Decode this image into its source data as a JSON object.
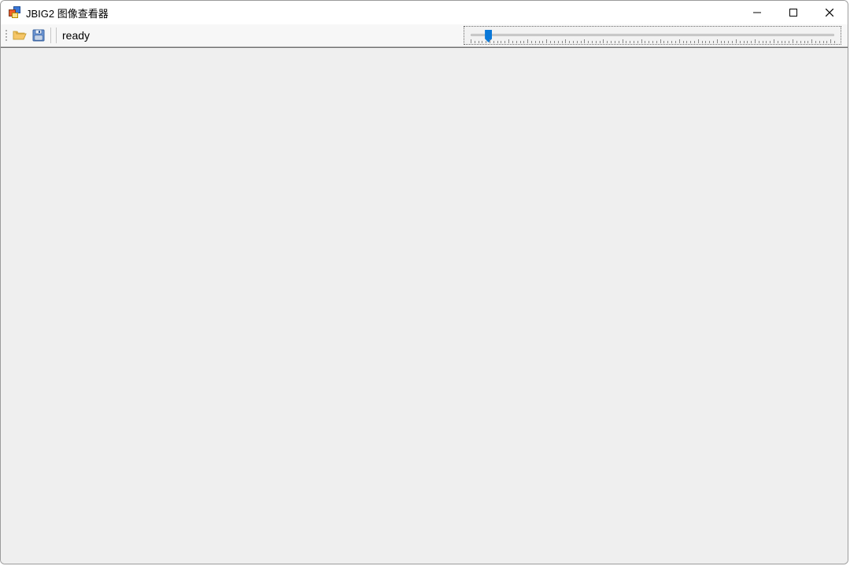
{
  "window": {
    "title": "JBIG2 图像查看器"
  },
  "toolbar": {
    "open_icon": "folder-open-icon",
    "save_icon": "save-icon",
    "status_text": "ready"
  },
  "slider": {
    "min": 0,
    "max": 100,
    "value": 4,
    "tick_count": 96
  },
  "colors": {
    "accent": "#0a78d8",
    "toolbar_bg": "#f7f7f7",
    "content_bg": "#efefef"
  }
}
